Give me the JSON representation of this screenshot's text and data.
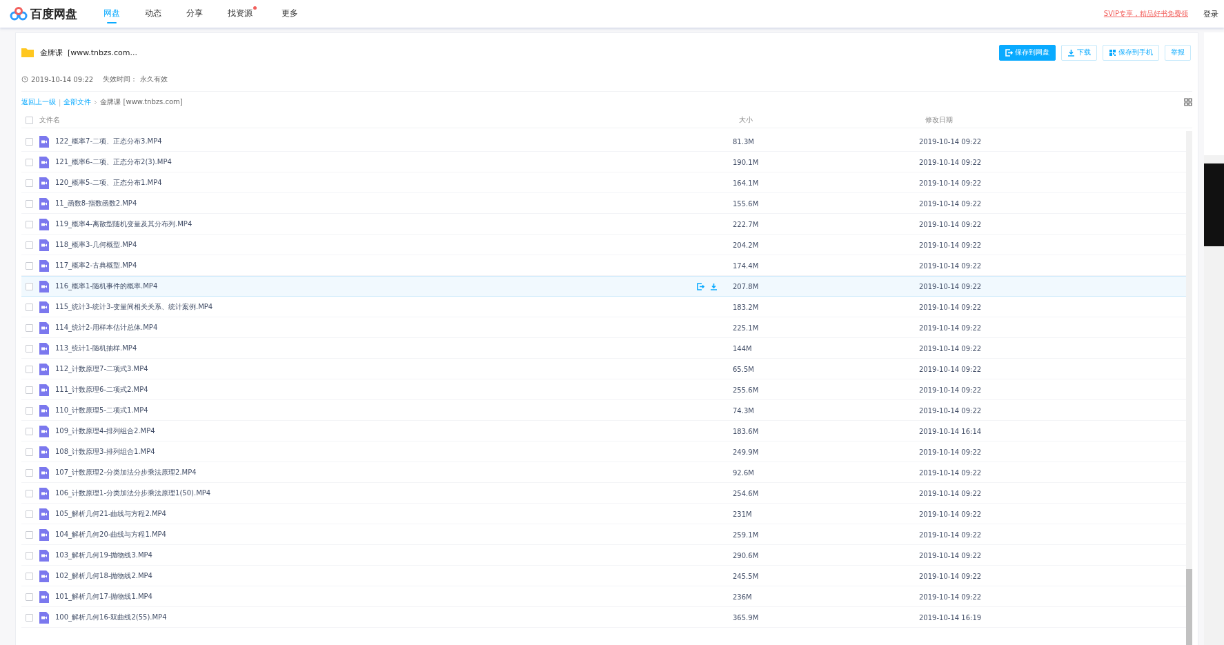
{
  "header": {
    "logo": "百度网盘",
    "nav": [
      {
        "label": "网盘",
        "selected": true,
        "badge": false
      },
      {
        "label": "动态",
        "selected": false,
        "badge": false
      },
      {
        "label": "分享",
        "selected": false,
        "badge": false
      },
      {
        "label": "找资源",
        "selected": false,
        "badge": true
      },
      {
        "label": "更多",
        "selected": false,
        "badge": false
      }
    ],
    "promo": "SVIP专享，精品好书免费领",
    "login": "登录"
  },
  "share": {
    "title": "金牌课  [www.tnbzs.com...",
    "time": "2019-10-14 09:22",
    "expiry_label": "失效时间：",
    "expiry": "永久有效",
    "actions": [
      {
        "label": "保存到网盘",
        "kind": "save",
        "primary": true
      },
      {
        "label": "下载",
        "kind": "download",
        "primary": false
      },
      {
        "label": "保存到手机",
        "kind": "phone",
        "primary": false
      },
      {
        "label": "举报",
        "kind": "report",
        "primary": false
      }
    ]
  },
  "breadcrumb": {
    "back": "返回上一级",
    "separator": "|",
    "all": "全部文件",
    "current": "金牌课 [www.tnbzs.com]"
  },
  "table": {
    "select_all_checked": false,
    "columns": [
      "文件名",
      "大小",
      "修改日期"
    ],
    "rows": [
      {
        "name": "122_概率7-二项、正态分布3.MP4",
        "size": "81.3M",
        "date": "2019-10-14 09:22",
        "checked": false,
        "highlighted": false
      },
      {
        "name": "121_概率6-二项、正态分布2(3).MP4",
        "size": "190.1M",
        "date": "2019-10-14 09:22",
        "checked": false,
        "highlighted": false
      },
      {
        "name": "120_概率5-二项、正态分布1.MP4",
        "size": "164.1M",
        "date": "2019-10-14 09:22",
        "checked": false,
        "highlighted": false
      },
      {
        "name": "11_函数8-指数函数2.MP4",
        "size": "155.6M",
        "date": "2019-10-14 09:22",
        "checked": false,
        "highlighted": false
      },
      {
        "name": "119_概率4-离散型随机变量及其分布列.MP4",
        "size": "222.7M",
        "date": "2019-10-14 09:22",
        "checked": false,
        "highlighted": false
      },
      {
        "name": "118_概率3-几何概型.MP4",
        "size": "204.2M",
        "date": "2019-10-14 09:22",
        "checked": false,
        "highlighted": false
      },
      {
        "name": "117_概率2-古典概型.MP4",
        "size": "174.4M",
        "date": "2019-10-14 09:22",
        "checked": false,
        "highlighted": false
      },
      {
        "name": "116_概率1-随机事件的概率.MP4",
        "size": "207.8M",
        "date": "2019-10-14 09:22",
        "checked": false,
        "highlighted": true
      },
      {
        "name": "115_统计3-统计3-变量间相关关系、统计案例.MP4",
        "size": "183.2M",
        "date": "2019-10-14 09:22",
        "checked": false,
        "highlighted": false
      },
      {
        "name": "114_统计2-用样本估计总体.MP4",
        "size": "225.1M",
        "date": "2019-10-14 09:22",
        "checked": false,
        "highlighted": false
      },
      {
        "name": "113_统计1-随机抽样.MP4",
        "size": "144M",
        "date": "2019-10-14 09:22",
        "checked": false,
        "highlighted": false
      },
      {
        "name": "112_计数原理7-二项式3.MP4",
        "size": "65.5M",
        "date": "2019-10-14 09:22",
        "checked": false,
        "highlighted": false
      },
      {
        "name": "111_计数原理6-二项式2.MP4",
        "size": "255.6M",
        "date": "2019-10-14 09:22",
        "checked": false,
        "highlighted": false
      },
      {
        "name": "110_计数原理5-二项式1.MP4",
        "size": "74.3M",
        "date": "2019-10-14 09:22",
        "checked": false,
        "highlighted": false
      },
      {
        "name": "109_计数原理4-排列组合2.MP4",
        "size": "183.6M",
        "date": "2019-10-14 16:14",
        "checked": false,
        "highlighted": false
      },
      {
        "name": "108_计数原理3-排列组合1.MP4",
        "size": "249.9M",
        "date": "2019-10-14 09:22",
        "checked": false,
        "highlighted": false
      },
      {
        "name": "107_计数原理2-分类加法分步乘法原理2.MP4",
        "size": "92.6M",
        "date": "2019-10-14 09:22",
        "checked": false,
        "highlighted": false
      },
      {
        "name": "106_计数原理1-分类加法分步乘法原理1(50).MP4",
        "size": "254.6M",
        "date": "2019-10-14 09:22",
        "checked": false,
        "highlighted": false
      },
      {
        "name": "105_解析几何21-曲线与方程2.MP4",
        "size": "231M",
        "date": "2019-10-14 09:22",
        "checked": false,
        "highlighted": false
      },
      {
        "name": "104_解析几何20-曲线与方程1.MP4",
        "size": "259.1M",
        "date": "2019-10-14 09:22",
        "checked": false,
        "highlighted": false
      },
      {
        "name": "103_解析几何19-抛物线3.MP4",
        "size": "290.6M",
        "date": "2019-10-14 09:22",
        "checked": false,
        "highlighted": false
      },
      {
        "name": "102_解析几何18-抛物线2.MP4",
        "size": "245.5M",
        "date": "2019-10-14 09:22",
        "checked": false,
        "highlighted": false
      },
      {
        "name": "101_解析几何17-抛物线1.MP4",
        "size": "236M",
        "date": "2019-10-14 09:22",
        "checked": false,
        "highlighted": false
      },
      {
        "name": "100_解析几何16-双曲线2(55).MP4",
        "size": "365.9M",
        "date": "2019-10-14 16:19",
        "checked": false,
        "highlighted": false
      }
    ]
  }
}
